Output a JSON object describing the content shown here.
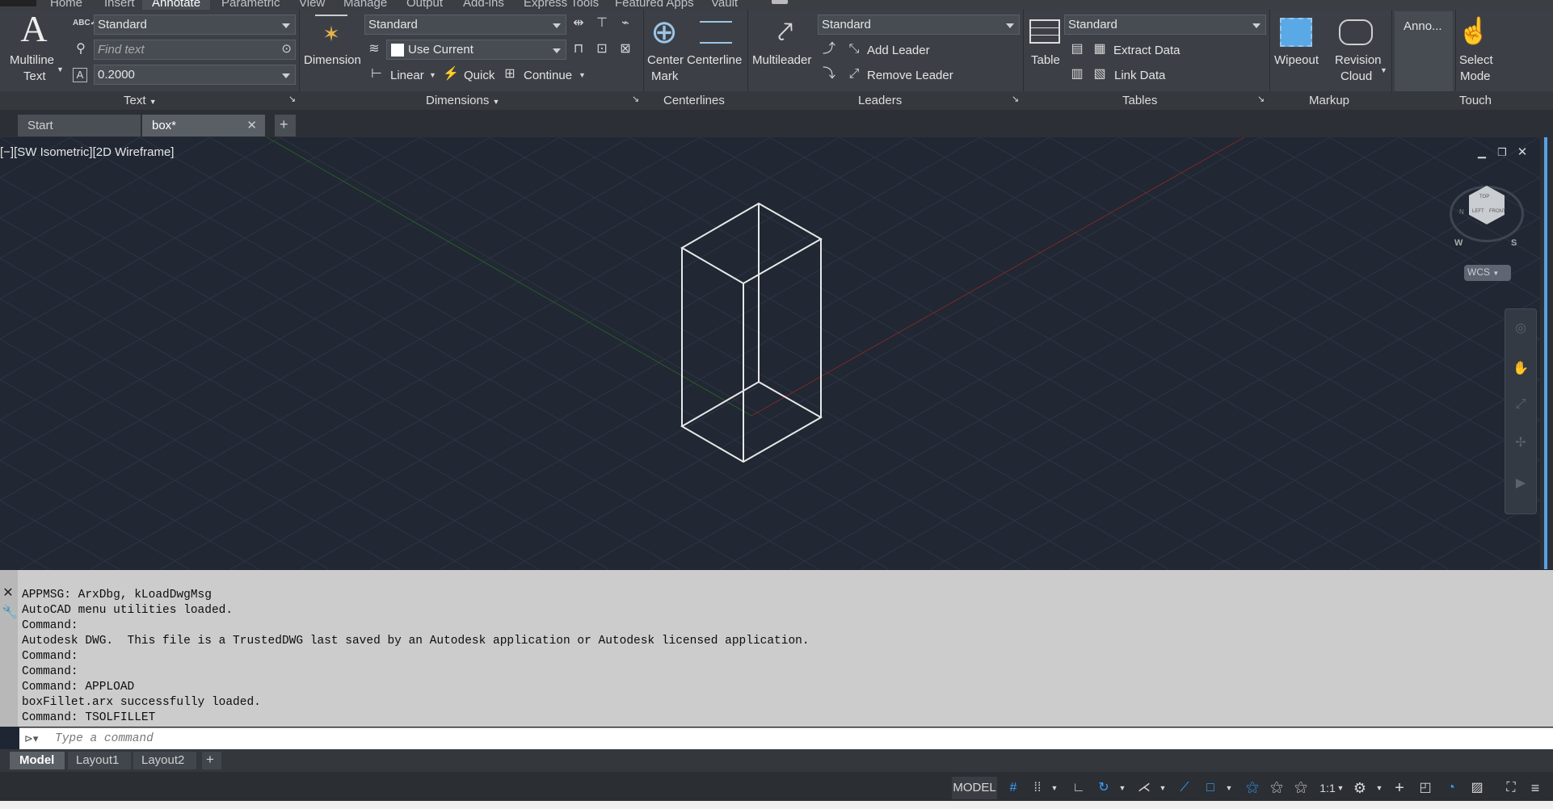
{
  "menu": {
    "tabs": [
      "Home",
      "Insert",
      "Annotate",
      "Parametric",
      "View",
      "Manage",
      "Output",
      "Add-ins",
      "Express Tools",
      "Featured Apps",
      "Vault"
    ],
    "active": "Annotate"
  },
  "ribbon": {
    "text_panel": {
      "multiline_line1": "Multiline",
      "multiline_line2": "Text",
      "style": "Standard",
      "find_placeholder": "Find text",
      "height": "0.2000",
      "title": "Text"
    },
    "dimensions_panel": {
      "dimension": "Dimension",
      "style": "Standard",
      "layer": "Use Current",
      "linear": "Linear",
      "quick": "Quick",
      "continue": "Continue",
      "title": "Dimensions"
    },
    "centerlines_panel": {
      "center_mark_line1": "Center",
      "center_mark_line2": "Mark",
      "centerline": "Centerline",
      "title": "Centerlines"
    },
    "leaders_panel": {
      "multileader": "Multileader",
      "style": "Standard",
      "add_leader": "Add Leader",
      "remove_leader": "Remove Leader",
      "title": "Leaders"
    },
    "tables_panel": {
      "table": "Table",
      "style": "Standard",
      "extract_data": "Extract Data",
      "link_data": "Link Data",
      "title": "Tables"
    },
    "markup_panel": {
      "wipeout": "Wipeout",
      "revision_line1": "Revision",
      "revision_line2": "Cloud",
      "title": "Markup"
    },
    "anno_panel": {
      "label": "Anno..."
    },
    "touch_panel": {
      "select_line1": "Select",
      "select_line2": "Mode",
      "title": "Touch"
    }
  },
  "doc_tabs": [
    {
      "label": "Start"
    },
    {
      "label": "box*"
    }
  ],
  "viewport": {
    "label": "[−][SW Isometric][2D Wireframe]",
    "wcs": "WCS",
    "compass": {
      "w": "W",
      "s": "S",
      "n": "N"
    },
    "cube_top": "TOP",
    "cube_left": "LEFT",
    "cube_front": "FRONT"
  },
  "command_history": [
    "APPMSG: ArxDbg, kLoadDwgMsg",
    "AutoCAD menu utilities loaded.",
    "Command:",
    "Autodesk DWG.  This file is a TrustedDWG last saved by an Autodesk application or Autodesk licensed application.",
    "Command:",
    "Command:",
    "Command: APPLOAD",
    "boxFillet.arx successfully loaded.",
    "Command: TSOLFILLET"
  ],
  "command_placeholder": "Type a command",
  "layout_tabs": [
    "Model",
    "Layout1",
    "Layout2"
  ],
  "status": {
    "model": "MODEL",
    "scale": "1:1"
  },
  "colors": {
    "viewport_bg": "#212733",
    "ribbon_bg": "#3c4046",
    "accent": "#3aa0ff"
  }
}
